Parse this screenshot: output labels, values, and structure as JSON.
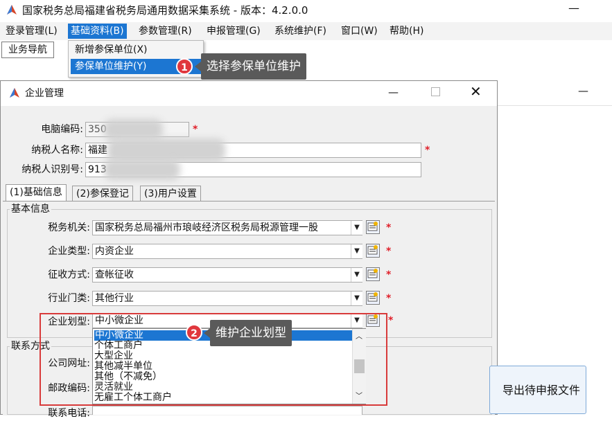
{
  "app": {
    "title": "国家税务总局福建省税务局通用数据采集系统 - 版本：4.2.0.0",
    "minimize_glyph": "—"
  },
  "menubar": {
    "items": [
      "登录管理(L)",
      "基础资料(B)",
      "参数管理(R)",
      "申报管理(G)",
      "系统维护(F)",
      "窗口(W)",
      "帮助(H)"
    ],
    "active_index": 1
  },
  "nav_tab": "业务导航",
  "dropdown": {
    "items": [
      "新增参保单位(X)",
      "参保单位维护(Y)"
    ],
    "highlighted_index": 1
  },
  "annotations": {
    "step1": {
      "number": "1",
      "text": "选择参保单位维护"
    },
    "step2": {
      "number": "2",
      "text": "维护企业划型"
    }
  },
  "dialog": {
    "title": "企业管理",
    "min_glyph": "—",
    "close_glyph": "✕",
    "fields": {
      "computer_code": {
        "label": "电脑编码:",
        "value": "350"
      },
      "taxpayer_name": {
        "label": "纳税人名称:",
        "value": "福建"
      },
      "taxpayer_id": {
        "label": "纳税人识别号:",
        "value": "913"
      }
    },
    "required_mark": "*",
    "tabs": [
      "(1)基础信息",
      "(2)参保登记",
      "(3)用户设置"
    ],
    "basic_info": {
      "group_label": "基本信息",
      "rows": [
        {
          "label": "税务机关:",
          "value": "国家税务总局福州市琅岐经济区税务局税源管理一股"
        },
        {
          "label": "企业类型:",
          "value": "内资企业"
        },
        {
          "label": "征收方式:",
          "value": "查帐征收"
        },
        {
          "label": "行业门类:",
          "value": "其他行业"
        },
        {
          "label": "企业划型:",
          "value": "中小微企业"
        }
      ]
    },
    "enterprise_type_options": [
      "中小微企业",
      "个体工商户",
      "大型企业",
      "其他减半单位",
      "其他（不减免）",
      "灵活就业",
      "无雇工个体工商户"
    ],
    "contact": {
      "group_label": "联系方式",
      "labels": [
        "公司网址:",
        "邮政编码:",
        "联系电话:"
      ]
    }
  },
  "export_button": "导出待申报文件",
  "colors": {
    "selection": "#1c76d2",
    "required": "#e0202a",
    "callout_bg": "#5a5a5a",
    "badge": "#e0373d",
    "highlight_box": "#d83a3a"
  }
}
